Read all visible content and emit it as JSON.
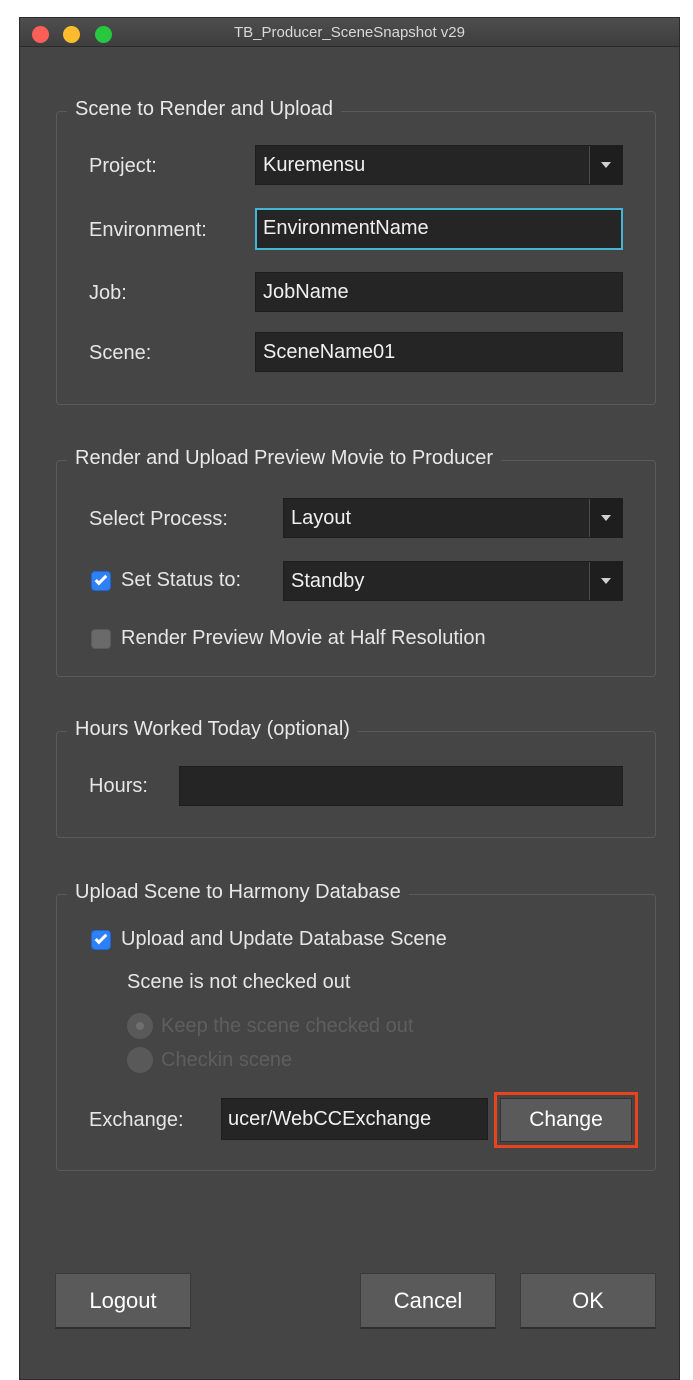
{
  "window": {
    "title": "TB_Producer_SceneSnapshot v29"
  },
  "scene_group": {
    "legend": "Scene to Render and Upload",
    "project_label": "Project:",
    "project_value": "Kuremensu",
    "environment_label": "Environment:",
    "environment_value": "EnvironmentName",
    "job_label": "Job:",
    "job_value": "JobName",
    "scene_label": "Scene:",
    "scene_value": "SceneName01"
  },
  "render_group": {
    "legend": "Render and Upload Preview Movie to Producer",
    "process_label": "Select Process:",
    "process_value": "Layout",
    "status_label": "Set Status to:",
    "status_checked": true,
    "status_value": "Standby",
    "half_res_label": "Render Preview Movie at Half Resolution",
    "half_res_checked": false
  },
  "hours_group": {
    "legend": "Hours Worked Today (optional)",
    "hours_label": "Hours:",
    "hours_value": ""
  },
  "upload_group": {
    "legend": "Upload Scene to Harmony Database",
    "upload_label": "Upload and Update Database Scene",
    "upload_checked": true,
    "checkout_status": "Scene is not checked out",
    "keep_label": "Keep the scene checked out",
    "checkin_label": "Checkin scene",
    "exchange_label": "Exchange:",
    "exchange_value": "ucer/WebCCExchange",
    "change_button": "Change"
  },
  "footer": {
    "logout_button": "Logout",
    "cancel_button": "Cancel",
    "ok_button": "OK"
  },
  "colors": {
    "window_bg": "#454545",
    "field_bg": "#252525",
    "focus_border": "#45b5d6",
    "checkbox_accent": "#2f7ff6",
    "highlight_border": "#e8431b"
  }
}
